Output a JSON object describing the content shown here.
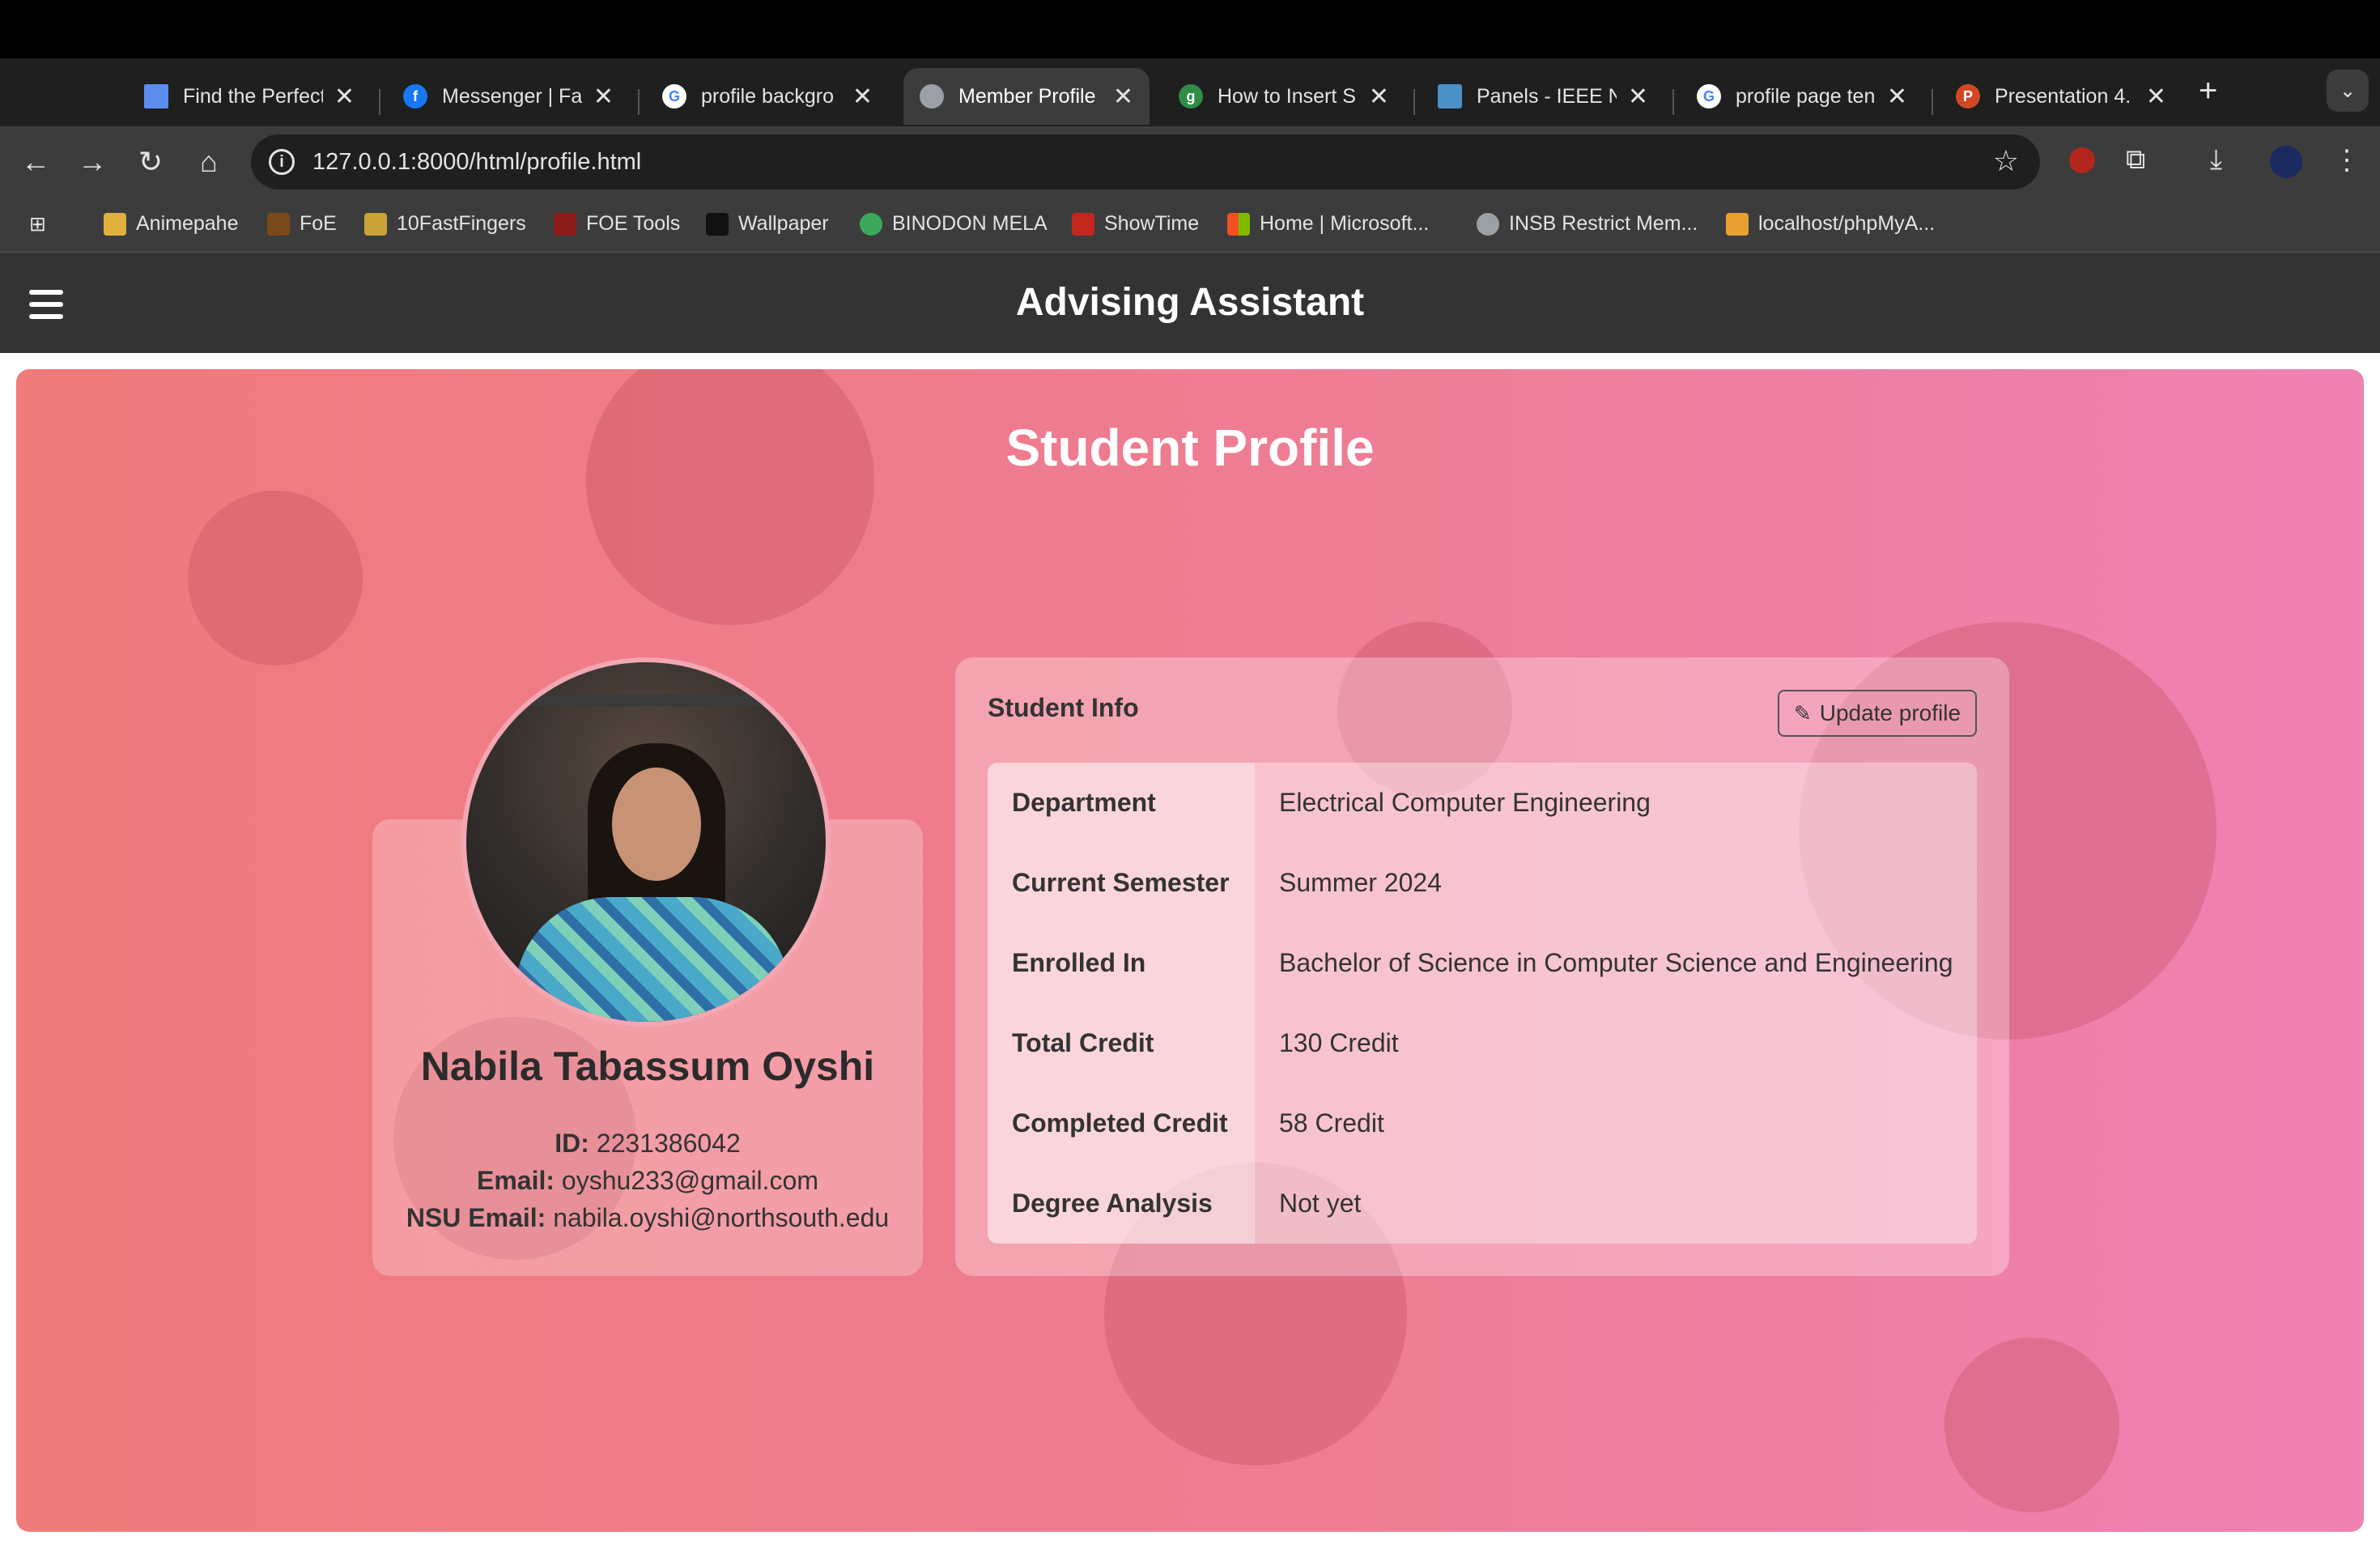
{
  "browser": {
    "tabs": [
      {
        "title": "Find the Perfect",
        "favicon": "flag-icon",
        "color": "#5b8def"
      },
      {
        "title": "Messenger | Fac",
        "favicon": "facebook-icon",
        "color": "#1877f2"
      },
      {
        "title": "profile backgro",
        "favicon": "google-icon",
        "color": "#ffffff"
      },
      {
        "title": "Member Profile",
        "favicon": "globe-icon",
        "color": "#9aa0a6"
      },
      {
        "title": "How to Insert S",
        "favicon": "geeksforgeeks-icon",
        "color": "#2f8d46"
      },
      {
        "title": "Panels - IEEE N",
        "favicon": "ieee-icon",
        "color": "#4a90c8"
      },
      {
        "title": "profile page ten",
        "favicon": "google-icon",
        "color": "#ffffff"
      },
      {
        "title": "Presentation 4.",
        "favicon": "powerpoint-icon",
        "color": "#d24726"
      }
    ],
    "active_tab": "Member Profile",
    "url": "127.0.0.1:8000/html/profile.html",
    "bookmarks": [
      "Animepahe",
      "FoE",
      "10FastFingers",
      "FOE Tools",
      "Wallpaper",
      "BINODON MELA",
      "ShowTime",
      "Home | Microsoft...",
      "INSB Restrict Mem...",
      "localhost/phpMyA..."
    ]
  },
  "app": {
    "title": "Advising Assistant"
  },
  "page": {
    "title": "Student Profile",
    "student": {
      "name": "Nabila Tabassum Oyshi",
      "id_label": "ID:",
      "id": "2231386042",
      "email_label": "Email:",
      "email": "oyshu233@gmail.com",
      "nsu_email_label": "NSU Email:",
      "nsu_email": "nabila.oyshi@northsouth.edu"
    },
    "info": {
      "title": "Student Info",
      "update_label": "Update profile",
      "rows": [
        {
          "label": "Department",
          "value": "Electrical Computer Engineering"
        },
        {
          "label": "Current Semester",
          "value": "Summer 2024"
        },
        {
          "label": "Enrolled In",
          "value": "Bachelor of Science in Computer Science and Engineering"
        },
        {
          "label": "Total Credit",
          "value": "130 Credit"
        },
        {
          "label": "Completed Credit",
          "value": "58 Credit"
        },
        {
          "label": "Degree Analysis",
          "value": "Not yet"
        }
      ]
    }
  },
  "colors": {
    "gradient_start": "#f07b7b",
    "gradient_end": "#ef82b3",
    "header_bg": "#333333"
  }
}
